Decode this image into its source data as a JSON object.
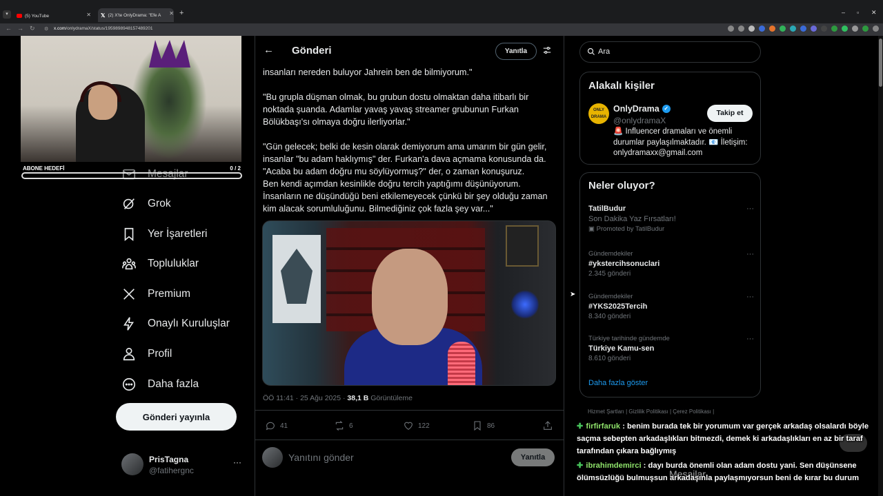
{
  "browser": {
    "tabs": [
      {
        "title": "(5) YouTube"
      },
      {
        "title": "(2) X'te OnlyDrama: \"Efe A"
      }
    ],
    "url_host": "x.com",
    "url_path": "/onlydramaX/status/1959898948157489201"
  },
  "stream_overlay": {
    "goal_label": "ABONE HEDEFİ",
    "goal_count": "0 / 2"
  },
  "sidebar": {
    "items": [
      {
        "label": "Mesajlar",
        "icon": "envelope-icon"
      },
      {
        "label": "Grok",
        "icon": "grok-icon"
      },
      {
        "label": "Yer İşaretleri",
        "icon": "bookmark-icon"
      },
      {
        "label": "Topluluklar",
        "icon": "communities-icon"
      },
      {
        "label": "Premium",
        "icon": "x-logo-icon"
      },
      {
        "label": "Onaylı Kuruluşlar",
        "icon": "lightning-icon"
      },
      {
        "label": "Profil",
        "icon": "person-icon"
      },
      {
        "label": "Daha fazla",
        "icon": "more-circle-icon"
      }
    ],
    "post_button": "Gönderi yayınla",
    "account": {
      "name": "PrisTagna",
      "handle": "@fatihergnc",
      "more": "···"
    }
  },
  "main": {
    "title": "Gönderi",
    "reply_pill": "Yanıtla",
    "paragraphs": [
      "insanları nereden buluyor Jahrein ben de bilmiyorum.\"",
      "\"Bu grupla düşman olmak, bu grubun dostu olmaktan daha itibarlı bir\nnoktada şuanda. Adamlar yavaş yavaş streamer grubunun Furkan\nBölükbaşı'sı olmaya doğru ilerliyorlar.\"",
      "\"Gün gelecek; belki de kesin olarak demiyorum ama umarım bir gün gelir,\ninsanlar \"bu adam haklıymış\" der. Furkan'a dava açmama konusunda da.\n\"Acaba bu adam doğru mu söylüyormuş?\" der, o zaman konuşuruz.\nBen kendi açımdan kesinlikle doğru tercih yaptığımı düşünüyorum.\nİnsanların ne düşündüğü beni etkilemeyecek çünkü bir şey olduğu zaman\nkim alacak sorumluluğunu. Bilmediğiniz çok fazla şey var...\""
    ],
    "meta_time": "ÖÖ 11:41 · 25 Ağu 2025 · ",
    "meta_views": "38,1 B",
    "meta_views_label": " Görüntüleme",
    "actions": {
      "replies": "41",
      "reposts": "6",
      "likes": "122",
      "bookmarks": "86"
    },
    "reply_placeholder": "Yanıtını gönder",
    "reply_submit": "Yanıtla"
  },
  "right": {
    "search_placeholder": "Ara",
    "who_title": "Alakalı kişiler",
    "who": {
      "name": "OnlyDrama",
      "handle": "@onlydramaX",
      "avatar_text": "ONLY DRAMA",
      "follow": "Takip et",
      "bio": "🚨 Influencer dramaları ve önemli durumlar paylaşılmaktadır. 📧 İletişim: onlydramaxx@gmail.com"
    },
    "trends_title": "Neler oluyor?",
    "trends": [
      {
        "context": "",
        "title": "TatilBudur",
        "subtitle": "Son Dakika Yaz Fırsatları!",
        "extra": "Promoted by TatilBudur"
      },
      {
        "context": "Gündemdekiler",
        "title": "#ykstercihsonuclari",
        "subtitle": "2.345 gönderi",
        "extra": ""
      },
      {
        "context": "Gündemdekiler",
        "title": "#YKS2025Tercih",
        "subtitle": "8.340 gönderi",
        "extra": ""
      },
      {
        "context": "Türkiye tarihinde gündemde",
        "title": "Türkiye Kamu-sen",
        "subtitle": "8.610 gönderi",
        "extra": ""
      }
    ],
    "show_more": "Daha fazla göster",
    "footer": "Hizmet Şartları  |  Gizlilik Politikası  |  Çerez Politikası  |"
  },
  "chat": [
    {
      "user": "firfirfaruk",
      "text": " : benim burada tek bir yorumum var gerçek arkadaş olsalardı böyle saçma sebepten arkadaşlıkları bitmezdi, demek ki arkadaşlıkları en az bir taraf tarafından çıkara bağlıymış"
    },
    {
      "user": "ibrahimdemirci",
      "text": " : dayı burda önemli olan adam dostu yani. Sen düşünsene ölümsüzlüğü bulmuşsun arkadaşınla paylaşmıyorsun beni de kırar bu durum"
    }
  ],
  "dm_bar": "Mesajlar"
}
